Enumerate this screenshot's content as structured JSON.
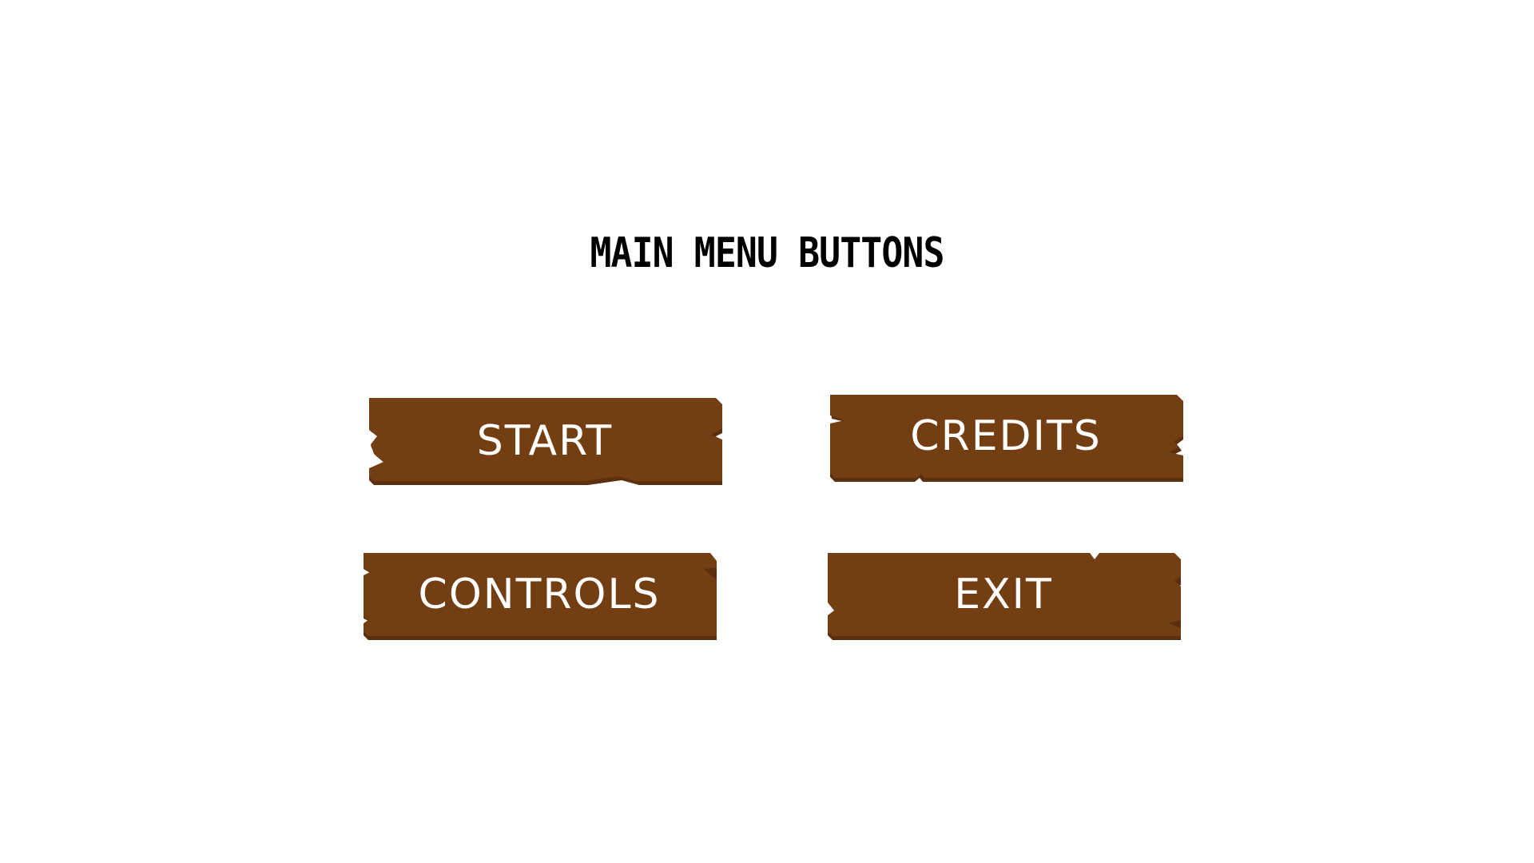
{
  "title": "MAIN MENU BUTTONS",
  "buttons": {
    "start": "START",
    "credits": "CREDITS",
    "controls": "CONTROLS",
    "exit": "EXIT"
  },
  "colors": {
    "wood": "#743e13",
    "wood_shadow": "#5c300f",
    "text": "#ffffff",
    "background": "#ffffff"
  }
}
